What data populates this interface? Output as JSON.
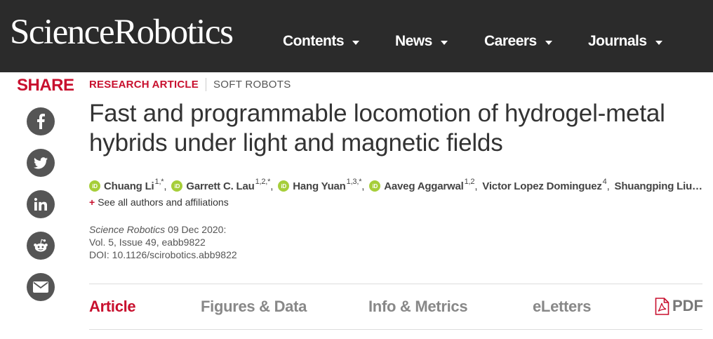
{
  "header": {
    "logo": "ScienceRobotics",
    "nav": [
      {
        "label": "Contents"
      },
      {
        "label": "News"
      },
      {
        "label": "Careers"
      },
      {
        "label": "Journals"
      }
    ]
  },
  "share": {
    "title": "SHARE",
    "icons": [
      "facebook-icon",
      "twitter-icon",
      "linkedin-icon",
      "reddit-icon",
      "email-icon"
    ],
    "icon_color": "#555555"
  },
  "article": {
    "type": "RESEARCH ARTICLE",
    "subject": "SOFT ROBOTS",
    "title": "Fast and programmable locomotion of hydrogel-metal hybrids under light and magnetic fields",
    "authors": [
      {
        "name": "Chuang Li",
        "aff": "1,*",
        "orcid": true
      },
      {
        "name": "Garrett C. Lau",
        "aff": "1,2,*",
        "orcid": true
      },
      {
        "name": "Hang Yuan",
        "aff": "1,3,*",
        "orcid": true
      },
      {
        "name": "Aaveg Aggarwal",
        "aff": "1,2",
        "orcid": true
      },
      {
        "name": "Victor Lopez Dominguez",
        "aff": "4",
        "orcid": false
      },
      {
        "name": "Shuangping Liu",
        "aff": "",
        "orcid": false
      }
    ],
    "orcid_label": "iD",
    "ellipsis": "…",
    "see_all": "See all authors and affiliations",
    "journal": "Science Robotics",
    "date": "09 Dec 2020:",
    "volume_line": "Vol. 5, Issue 49, eabb9822",
    "doi": "DOI: 10.1126/scirobotics.abb9822"
  },
  "tabs": [
    {
      "label": "Article",
      "active": true
    },
    {
      "label": "Figures & Data",
      "active": false
    },
    {
      "label": "Info & Metrics",
      "active": false
    },
    {
      "label": "eLetters",
      "active": false
    },
    {
      "label": "PDF",
      "active": false
    }
  ],
  "colors": {
    "accent": "#c8102e",
    "header_bg": "#2b2b2b",
    "orcid": "#a6ce39"
  }
}
